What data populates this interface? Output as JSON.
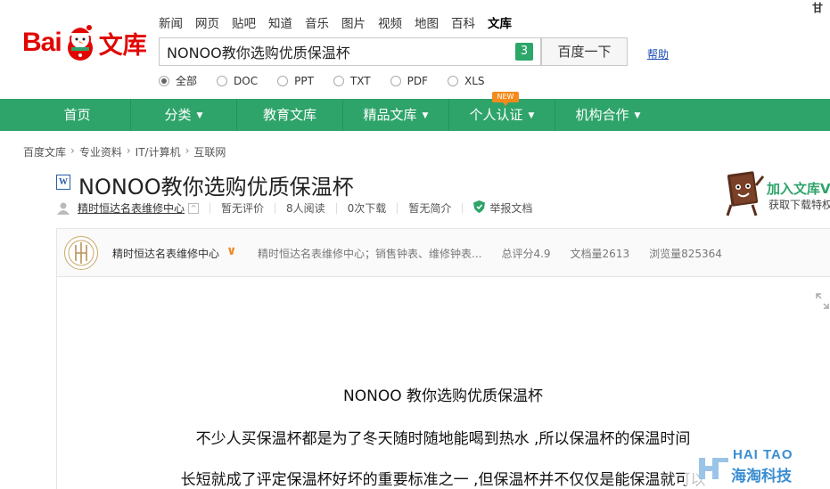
{
  "header": {
    "logo_text_en": "Bai",
    "logo_text_cn": "文库",
    "top_nav": [
      "新闻",
      "网页",
      "贴吧",
      "知道",
      "音乐",
      "图片",
      "视频",
      "地图",
      "百科",
      "文库"
    ],
    "top_nav_active": "文库",
    "search": {
      "value": "NONOO教你选购优质保温杯",
      "count": "3"
    },
    "search_button": "百度一下",
    "help_link": "帮助",
    "user_name": "甘",
    "filetypes": [
      {
        "label": "全部",
        "checked": true
      },
      {
        "label": "DOC",
        "checked": false
      },
      {
        "label": "PPT",
        "checked": false
      },
      {
        "label": "TXT",
        "checked": false
      },
      {
        "label": "PDF",
        "checked": false
      },
      {
        "label": "XLS",
        "checked": false
      }
    ]
  },
  "mainnav": {
    "items": [
      {
        "label": "首页",
        "dropdown": false
      },
      {
        "label": "分类",
        "dropdown": true
      },
      {
        "label": "教育文库",
        "dropdown": false
      },
      {
        "label": "精品文库",
        "dropdown": true
      },
      {
        "label": "个人认证",
        "dropdown": true
      },
      {
        "label": "机构合作",
        "dropdown": true
      }
    ],
    "new_badge": "NEW",
    "accent_color": "#2ea46a"
  },
  "breadcrumb": [
    "百度文库",
    "专业资料",
    "IT/计算机",
    "互联网"
  ],
  "document": {
    "type_icon": "W",
    "title": "NONOO教你选购优质保温杯",
    "uploader": "精时恒达名表维修中心",
    "rating": "暂无评价",
    "reads": "8人阅读",
    "downloads": "0次下载",
    "summary": "暂无简介",
    "report": "举报文档"
  },
  "author_bar": {
    "name": "精时恒达名表维修中心",
    "description": "精时恒达名表维修中心；销售钟表、维修钟表...",
    "total_score": "总评分4.9",
    "doc_count": "文档量2613",
    "views": "浏览量825364"
  },
  "join": {
    "title": "加入文库V",
    "subtitle": "获取下载特权"
  },
  "content": {
    "heading": "NONOO 教你选购优质保温杯",
    "line1": "不少人买保温杯都是为了冬天随时随地能喝到热水 ,所以保温杯的保温时间",
    "line2": "长短就成了评定保温杯好坏的重要标准之一 ,但保温杯并不仅仅是能保温就可以"
  },
  "watermark": {
    "en": "HAI TAO",
    "cn": "海淘科技"
  }
}
